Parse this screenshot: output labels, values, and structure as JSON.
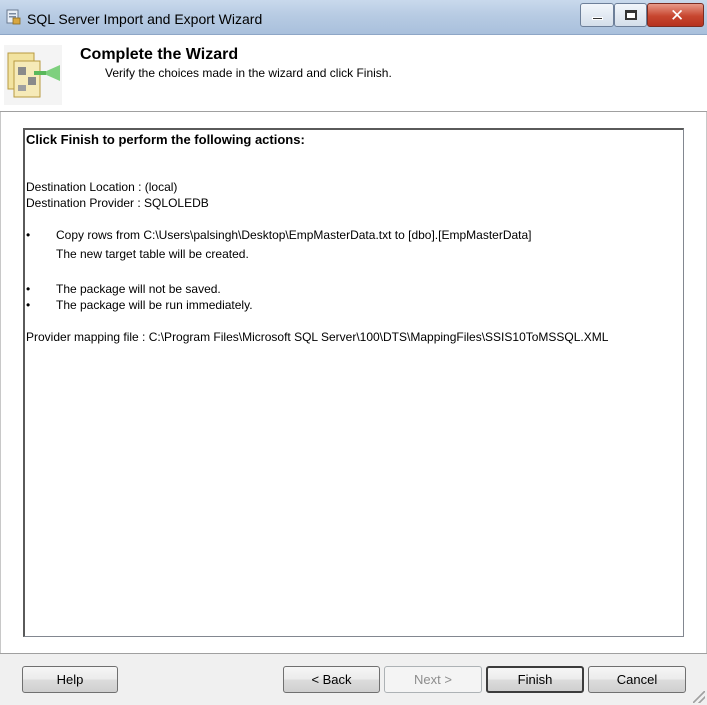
{
  "window": {
    "title": "SQL Server Import and Export Wizard",
    "icon": "wizard-app-icon",
    "controls": [
      "minimize-icon",
      "maximize-icon",
      "close-icon"
    ]
  },
  "header": {
    "title": "Complete the Wizard",
    "subtitle": "Verify the choices made in the wizard and click Finish.",
    "icon": "wizard-banner-icon"
  },
  "report": {
    "heading": "Click Finish to perform the following actions:",
    "destination_location": "Destination Location : (local)",
    "destination_provider": "Destination Provider : SQLOLEDB",
    "bullets": [
      "•",
      "•",
      "•"
    ],
    "copy_rows": "Copy rows from C:\\Users\\palsingh\\Desktop\\EmpMasterData.txt to [dbo].[EmpMasterData]",
    "new_table": "The new target table will be created.",
    "not_saved": "The package will not be saved.",
    "run_immediately": "The package will be run immediately.",
    "provider_mapping": "Provider mapping file : C:\\Program Files\\Microsoft SQL Server\\100\\DTS\\MappingFiles\\SSIS10ToMSSQL.XML"
  },
  "footer": {
    "help_label": "Help",
    "back_label": "< Back",
    "next_label": "Next >",
    "finish_label": "Finish",
    "cancel_label": "Cancel"
  },
  "colors": {
    "titlebar": "#b7cbe3",
    "close_button": "#c7462f",
    "footer_bg": "#f0f0f0"
  }
}
